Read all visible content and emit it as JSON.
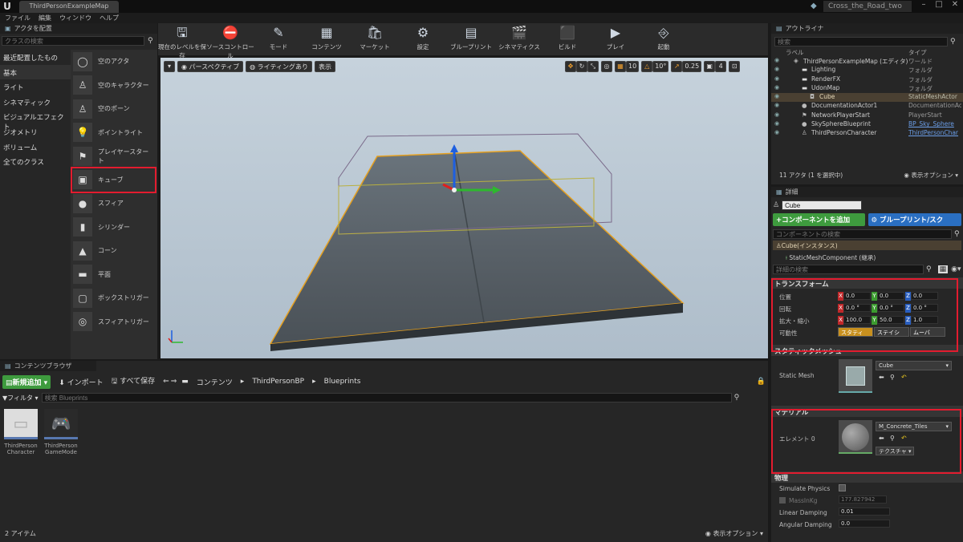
{
  "title_bar": {
    "map_tab": "ThirdPersonExampleMap",
    "project_name": "Cross_the_Road_two"
  },
  "menu": [
    "ファイル",
    "編集",
    "ウィンドウ",
    "ヘルプ"
  ],
  "place_panel": {
    "tab": "アクタを配置",
    "search_placeholder": "クラスの検索",
    "categories": [
      "最近配置したもの",
      "基本",
      "ライト",
      "シネマティック",
      "ビジュアルエフェクト",
      "ジオメトリ",
      "ボリューム",
      "全てのクラス"
    ],
    "selected_category": "基本",
    "actors": [
      "空のアクタ",
      "空のキャラクター",
      "空のポーン",
      "ポイントライト",
      "プレイヤースタート",
      "キューブ",
      "スフィア",
      "シリンダー",
      "コーン",
      "平面",
      "ボックストリガー",
      "スフィアトリガー"
    ],
    "highlighted_actor": "キューブ"
  },
  "toolbar": {
    "buttons": [
      {
        "label": "現在のレベルを保存",
        "icon": "save-icon"
      },
      {
        "label": "ソースコントロール",
        "icon": "source-control-icon"
      },
      {
        "label": "モード",
        "icon": "modes-icon"
      },
      {
        "label": "コンテンツ",
        "icon": "content-icon"
      },
      {
        "label": "マーケット",
        "icon": "marketplace-icon"
      },
      {
        "label": "設定",
        "icon": "settings-icon"
      },
      {
        "label": "ブループリント",
        "icon": "blueprint-icon"
      },
      {
        "label": "シネマティクス",
        "icon": "cinematics-icon"
      },
      {
        "label": "ビルド",
        "icon": "build-icon"
      },
      {
        "label": "プレイ",
        "icon": "play-icon"
      },
      {
        "label": "起動",
        "icon": "launch-icon"
      }
    ]
  },
  "viewport": {
    "perspective_label": "パースペクティブ",
    "lighting_label": "ライティングあり",
    "show_label": "表示",
    "grid_snap": "10",
    "rotation_snap": "10°",
    "scale_snap": "0.25",
    "camera_speed": "4"
  },
  "outliner": {
    "tab": "アウトライナ",
    "search_placeholder": "検索",
    "col_label": "ラベル",
    "col_type": "タイプ",
    "rows": [
      {
        "name": "ThirdPersonExampleMap (エディタ)",
        "type": "ワールド",
        "indent": 0,
        "icon": "world-icon"
      },
      {
        "name": "Lighting",
        "type": "フォルダ",
        "indent": 1,
        "icon": "folder-icon"
      },
      {
        "name": "RenderFX",
        "type": "フォルダ",
        "indent": 1,
        "icon": "folder-icon"
      },
      {
        "name": "UdonMap",
        "type": "フォルダ",
        "indent": 1,
        "icon": "folder-icon"
      },
      {
        "name": "Cube",
        "type": "StaticMeshActor",
        "indent": 2,
        "icon": "mesh-icon"
      },
      {
        "name": "DocumentationActor1",
        "type": "DocumentationAct",
        "indent": 1,
        "icon": "doc-icon"
      },
      {
        "name": "NetworkPlayerStart",
        "type": "PlayerStart",
        "indent": 1,
        "icon": "playerstart-icon"
      },
      {
        "name": "SkySphereBlueprint",
        "type": "BP_Sky_Sphere",
        "indent": 1,
        "icon": "sphere-icon"
      },
      {
        "name": "ThirdPersonCharacter",
        "type": "ThirdPersonChar",
        "indent": 1,
        "icon": "character-icon"
      }
    ],
    "selected_row": "Cube",
    "footer_count": "11 アクタ (1 を選択中)",
    "footer_view": "表示オプション"
  },
  "details": {
    "tab": "詳細",
    "name_value": "Cube",
    "add_component": "+コンポーネントを追加",
    "blueprint_script": "ブループリント/スク",
    "component_search_placeholder": "コンポーネントの検索",
    "instance": "Cube(インスタンス)",
    "component": "StaticMeshComponent (継承)",
    "details_search_placeholder": "詳細の検索",
    "transform": {
      "header": "トランスフォーム",
      "location_label": "位置",
      "rotation_label": "回転",
      "scale_label": "拡大・縮小",
      "mobility_label": "可動性",
      "location": [
        "0.0",
        "0.0",
        "0.0"
      ],
      "rotation": [
        "0.0 °",
        "0.0 °",
        "0.0 °"
      ],
      "scale": [
        "100.0",
        "50.0",
        "1.0"
      ],
      "mobility": [
        "スタティ",
        "ステイシ",
        "ムーバ"
      ]
    },
    "static_mesh": {
      "header": "スタティックメッシュ",
      "label": "Static Mesh",
      "value": "Cube"
    },
    "material": {
      "header": "マテリアル",
      "label": "エレメント 0",
      "value": "M_Concrete_Tiles",
      "texture_btn": "テクスチャ"
    },
    "physics": {
      "header": "物理",
      "simulate_label": "Simulate Physics",
      "mass_label": "MassInKg",
      "mass_value": "177.827942",
      "linear_label": "Linear Damping",
      "linear_value": "0.01",
      "angular_label": "Angular Damping",
      "angular_value": "0.0"
    }
  },
  "content_browser": {
    "tab": "コンテンツブラウザ",
    "add_new": "新規追加",
    "import": "インポート",
    "save_all": "すべて保存",
    "path": [
      "コンテンツ",
      "ThirdPersonBP",
      "Blueprints"
    ],
    "filter": "フィルタ",
    "search_placeholder": "検索 Blueprints",
    "assets": [
      {
        "line1": "ThirdPerson",
        "line2": "Character"
      },
      {
        "line1": "ThirdPerson",
        "line2": "GameMode"
      }
    ],
    "item_count": "2 アイテム",
    "view_options": "表示オプション"
  }
}
